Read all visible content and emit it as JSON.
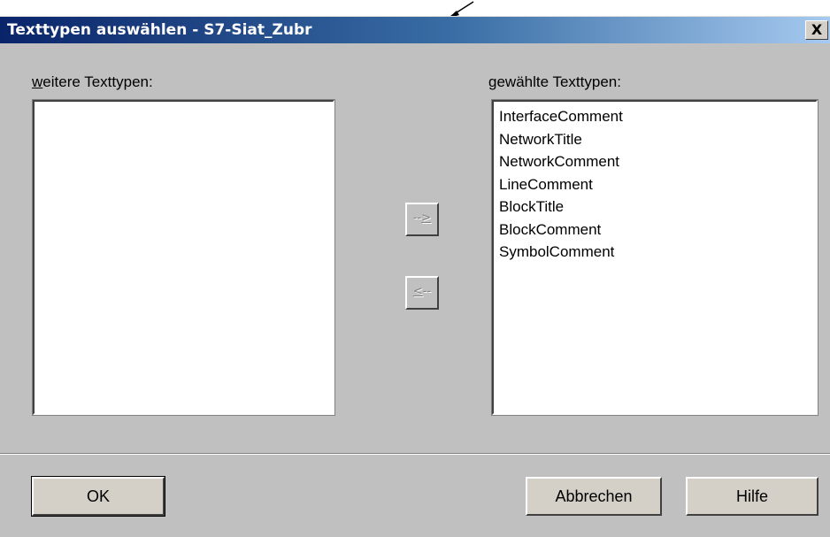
{
  "dialog": {
    "title": "Texttypen auswählen - S7-Siat_Zubr",
    "close_label": "X"
  },
  "left_list": {
    "label_accel": "w",
    "label_rest": "eitere Texttypen:",
    "items": []
  },
  "right_list": {
    "label_accel": "g",
    "label_rest": "ewählte Texttypen:",
    "items": [
      "InterfaceComment",
      "NetworkTitle",
      "NetworkComment",
      "LineComment",
      "BlockTitle",
      "BlockComment",
      "SymbolComment"
    ]
  },
  "move_right_button": {
    "prefix": "--",
    "accel": ">"
  },
  "move_left_button": {
    "accel": "<",
    "suffix": "--"
  },
  "buttons": {
    "ok": "OK",
    "cancel": "Abbrechen",
    "help": "Hilfe"
  },
  "colors": {
    "titlebar_start": "#0a246a",
    "titlebar_end": "#a6caf0",
    "face": "#c0c0c0"
  }
}
